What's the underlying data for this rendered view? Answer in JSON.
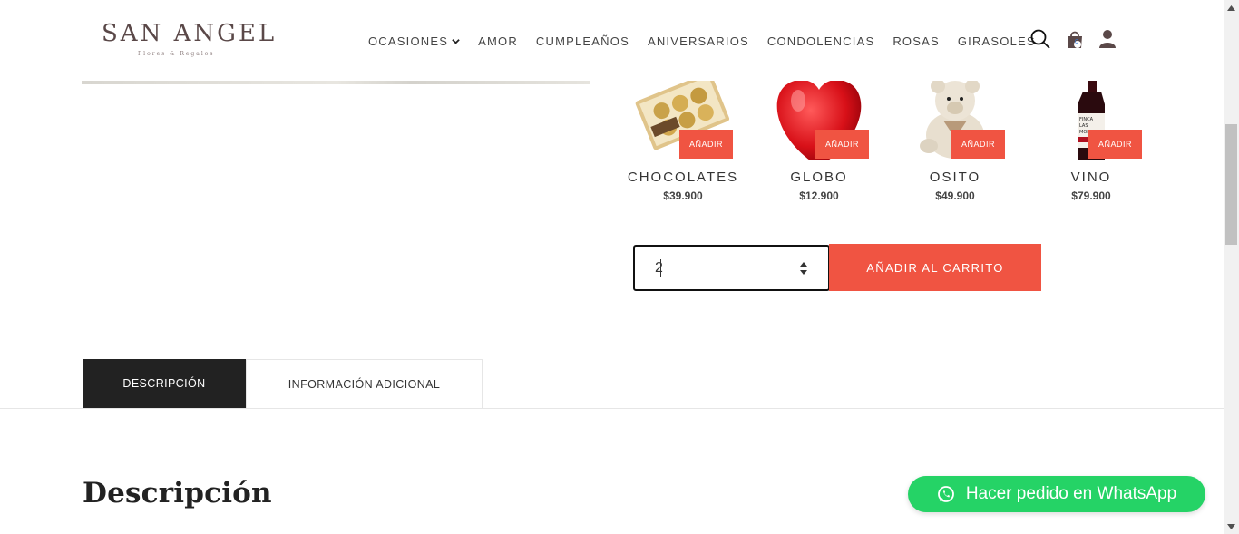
{
  "brand": {
    "name": "SAN ANGEL",
    "tagline": "Flores & Regalos"
  },
  "nav": {
    "items": [
      {
        "label": "OCASIONES",
        "has_dropdown": true
      },
      {
        "label": "AMOR"
      },
      {
        "label": "CUMPLEAÑOS"
      },
      {
        "label": "ANIVERSARIOS"
      },
      {
        "label": "CONDOLENCIAS"
      },
      {
        "label": "ROSAS"
      },
      {
        "label": "GIRASOLES"
      }
    ],
    "icons": [
      "search-icon",
      "cart-icon",
      "user-icon"
    ],
    "cart_count": "0"
  },
  "addons": [
    {
      "name": "CHOCOLATES",
      "price": "$39.900",
      "add_label": "AÑADIR",
      "image": "chocolates-image"
    },
    {
      "name": "GLOBO",
      "price": "$12.900",
      "add_label": "AÑADIR",
      "image": "balloon-image"
    },
    {
      "name": "OSITO",
      "price": "$49.900",
      "add_label": "AÑADIR",
      "image": "teddy-bear-image"
    },
    {
      "name": "VINO",
      "price": "$79.900",
      "add_label": "AÑADIR",
      "image": "wine-image"
    }
  ],
  "cart": {
    "quantity": "2",
    "add_to_cart_label": "AÑADIR AL CARRITO"
  },
  "tabs": [
    {
      "label": "DESCRIPCIÓN",
      "active": true
    },
    {
      "label": "INFORMACIÓN ADICIONAL",
      "active": false
    }
  ],
  "section_title": "Descripción",
  "whatsapp": {
    "label": "Hacer pedido en WhatsApp"
  },
  "colors": {
    "accent": "#f05442",
    "tab_active": "#222222",
    "whatsapp": "#25d366"
  }
}
